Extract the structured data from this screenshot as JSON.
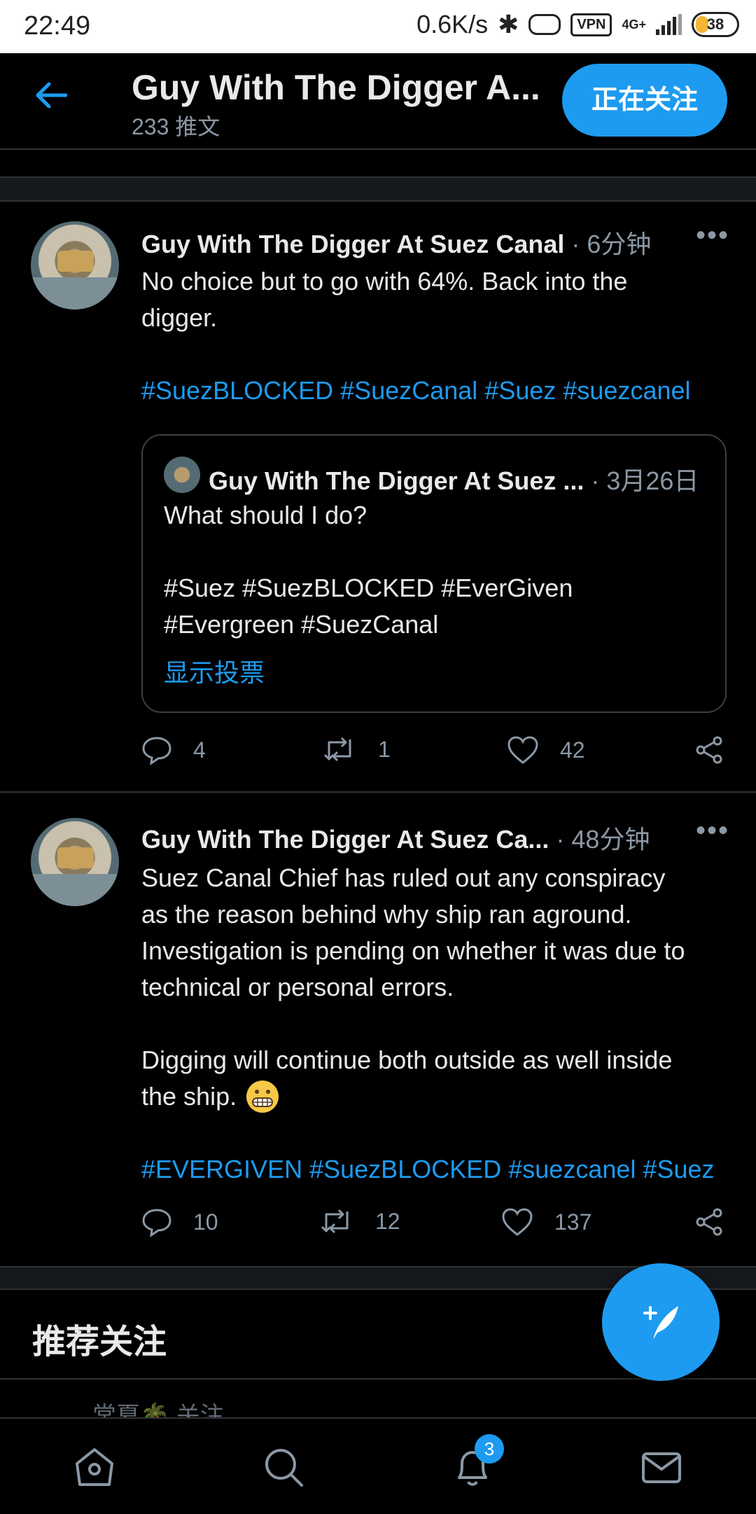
{
  "status_bar": {
    "time": "22:49",
    "net_speed": "0.6K/s",
    "vpn_label": "VPN",
    "network": "4G+",
    "battery": "38"
  },
  "header": {
    "title": "Guy With The Digger A...",
    "subtitle": "233 推文",
    "follow_button": "正在关注"
  },
  "tweets": [
    {
      "name": "Guy With The Digger At Suez Canal",
      "meta": "· 6分钟",
      "text_lines": [
        "No choice but to go with 64%. Back into the",
        "digger."
      ],
      "tags": [
        "#SuezBLOCKED",
        "#SuezCanal",
        "#Suez",
        "#suezcanel"
      ],
      "quote": {
        "name": "Guy With The Digger At Suez ...",
        "meta": "· 3月26日",
        "line1": "What should I do?",
        "tags_line1": [
          "#Suez",
          "#SuezBLOCKED",
          "#EverGiven"
        ],
        "tags_line2": [
          "#Evergreen",
          "#SuezCanal"
        ],
        "poll_link": "显示投票"
      },
      "replies": "4",
      "retweets": "1",
      "likes": "42"
    },
    {
      "name": "Guy With The Digger At Suez Ca...",
      "meta": "· 48分钟",
      "text_lines": [
        "Suez Canal Chief has ruled out any conspiracy",
        "as the reason behind why ship ran aground.",
        "Investigation is pending on whether it was due to",
        "technical or personal errors.",
        "Digging will continue both outside as well inside",
        "the ship."
      ],
      "tags": [
        "#EVERGIVEN",
        "#SuezBLOCKED",
        "#suezcanel",
        "#Suez"
      ],
      "replies": "10",
      "retweets": "12",
      "likes": "137"
    }
  ],
  "recommend": {
    "title": "推荐关注",
    "peek_text": "常夏🌴 关注"
  },
  "bottom_nav": {
    "notification_badge": "3"
  },
  "colors": {
    "accent": "#1d9bf0",
    "background": "#000000",
    "muted": "#8b98a5"
  },
  "icons": [
    "back-arrow-icon",
    "more-icon",
    "reply-icon",
    "retweet-icon",
    "like-icon",
    "share-icon",
    "compose-icon",
    "home-icon",
    "search-icon",
    "bell-icon",
    "mail-icon"
  ]
}
